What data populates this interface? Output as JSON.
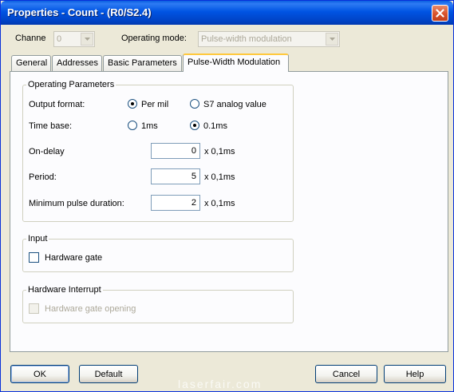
{
  "window": {
    "title": "Properties - Count - (R0/S2.4)"
  },
  "header": {
    "channel_label": "Channe",
    "channel_value": "0",
    "mode_label": "Operating mode:",
    "mode_value": "Pulse-width modulation"
  },
  "tabs": [
    {
      "label": "General"
    },
    {
      "label": "Addresses"
    },
    {
      "label": "Basic Parameters"
    },
    {
      "label": "Pulse-Width Modulation",
      "active": true
    }
  ],
  "operating_parameters": {
    "title": "Operating Parameters",
    "output_format": {
      "label": "Output format:",
      "options": [
        {
          "label": "Per mil",
          "selected": true
        },
        {
          "label": "S7 analog value",
          "selected": false
        }
      ]
    },
    "time_base": {
      "label": "Time base:",
      "options": [
        {
          "label": "1ms",
          "selected": false
        },
        {
          "label": "0.1ms",
          "selected": true
        }
      ]
    },
    "on_delay": {
      "label": "On-delay",
      "value": "0",
      "unit": "x 0,1ms"
    },
    "period": {
      "label": "Period:",
      "value": "5",
      "unit": "x 0,1ms"
    },
    "min_pulse": {
      "label": "Minimum pulse duration:",
      "value": "2",
      "unit": "x 0,1ms"
    }
  },
  "input": {
    "title": "Input",
    "hardware_gate": {
      "label": "Hardware gate",
      "checked": false
    }
  },
  "hardware_interrupt": {
    "title": "Hardware Interrupt",
    "gate_opening": {
      "label": "Hardware gate opening",
      "checked": false,
      "enabled": false
    }
  },
  "buttons": {
    "ok": "OK",
    "default": "Default",
    "cancel": "Cancel",
    "help": "Help"
  },
  "watermark": "laserfair.com",
  "colors": {
    "titlebar": "#0054E3",
    "dialog_bg": "#ECE9D8",
    "panel_bg": "#FCFCFE",
    "active_tab_accent": "#FFC83C",
    "close_button": "#D9532B"
  }
}
